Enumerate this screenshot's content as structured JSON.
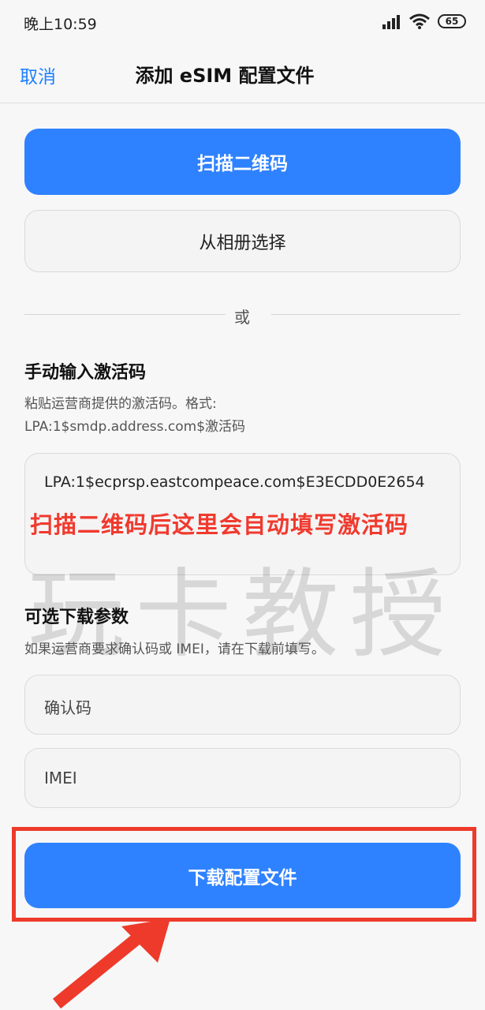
{
  "status_bar": {
    "time": "晚上10:59",
    "battery": "65",
    "icons": [
      "signal-icon",
      "wifi-icon",
      "battery-icon"
    ]
  },
  "nav": {
    "cancel_label": "取消",
    "title": "添加 eSIM 配置文件"
  },
  "actions": {
    "scan_label": "扫描二维码",
    "album_label": "从相册选择",
    "or_label": "或"
  },
  "manual": {
    "title": "手动输入激活码",
    "description": "粘贴运营商提供的激活码。格式: LPA:1$smdp.address.com$激活码",
    "value": "LPA:1$ecprsp.eastcompeace.com$E3ECDD0E2654",
    "annotation": "扫描二维码后这里会自动填写激活码"
  },
  "optional": {
    "title": "可选下载参数",
    "description": "如果运营商要求确认码或 IMEI，请在下载前填写。",
    "confirm_placeholder": "确认码",
    "imei_placeholder": "IMEI"
  },
  "download_label": "下载配置文件",
  "watermark": "玩卡教授",
  "colors": {
    "accent": "#2f82ff",
    "link": "#1e80ff",
    "annotation_red": "#ee3a2a"
  }
}
